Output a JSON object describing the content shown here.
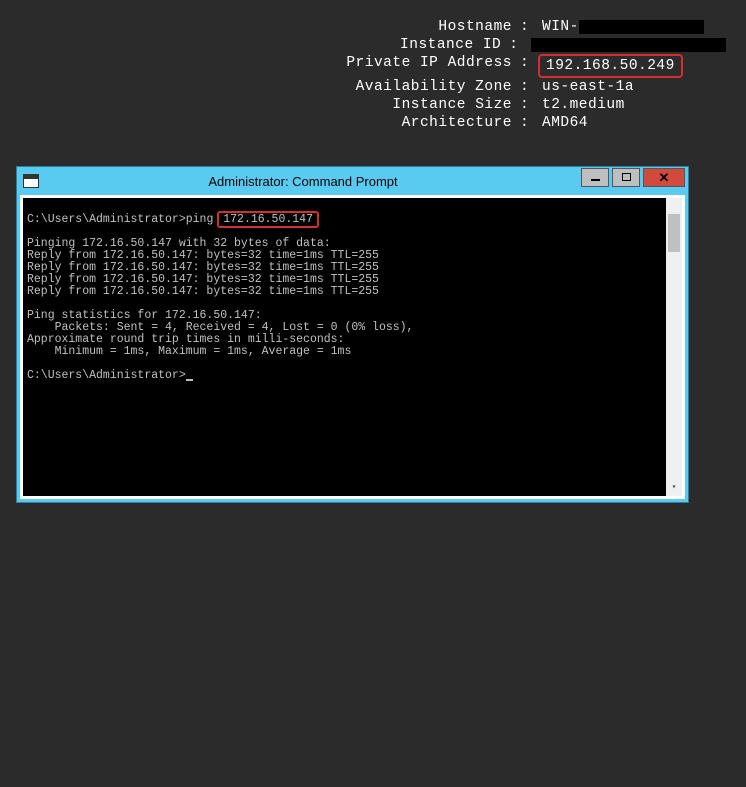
{
  "info": {
    "hostname_label": "Hostname",
    "hostname_value": "WIN-",
    "instance_id_label": "Instance ID",
    "private_ip_label": "Private IP Address",
    "private_ip_value": "192.168.50.249",
    "az_label": "Availability Zone",
    "az_value": "us-east-1a",
    "size_label": "Instance Size",
    "size_value": "t2.medium",
    "arch_label": "Architecture",
    "arch_value": "AMD64",
    "sep": ":"
  },
  "cmd": {
    "title": "Administrator: Command Prompt",
    "prompt1_path": "C:\\Users\\Administrator>",
    "prompt1_cmd": "ping ",
    "ping_target": "172.16.50.147",
    "out": {
      "l1": "Pinging 172.16.50.147 with 32 bytes of data:",
      "l2": "Reply from 172.16.50.147: bytes=32 time=1ms TTL=255",
      "l3": "Reply from 172.16.50.147: bytes=32 time=1ms TTL=255",
      "l4": "Reply from 172.16.50.147: bytes=32 time=1ms TTL=255",
      "l5": "Reply from 172.16.50.147: bytes=32 time=1ms TTL=255",
      "l6": "Ping statistics for 172.16.50.147:",
      "l7": "    Packets: Sent = 4, Received = 4, Lost = 0 (0% loss),",
      "l8": "Approximate round trip times in milli-seconds:",
      "l9": "    Minimum = 1ms, Maximum = 1ms, Average = 1ms"
    },
    "prompt2": "C:\\Users\\Administrator>"
  }
}
